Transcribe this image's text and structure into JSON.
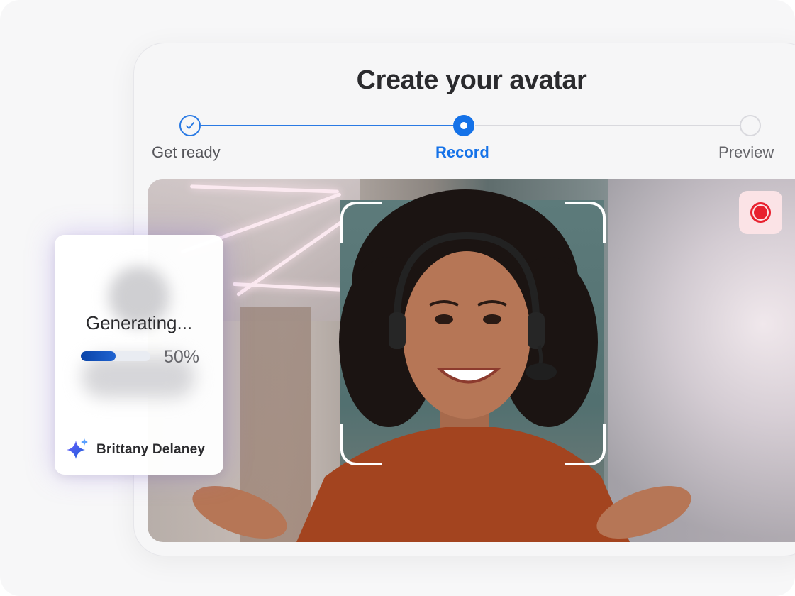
{
  "header": {
    "title": "Create your avatar"
  },
  "stepper": {
    "steps": [
      {
        "label": "Get ready",
        "state": "done"
      },
      {
        "label": "Record",
        "state": "active"
      },
      {
        "label": "Preview",
        "state": "todo"
      }
    ],
    "accent_color": "#1572e8"
  },
  "recorder": {
    "record_icon": "record-icon",
    "record_color": "#e8202e"
  },
  "generating_card": {
    "status": "Generating...",
    "progress_percent": 50,
    "progress_label": "50%",
    "user_name": "Brittany Delaney",
    "user_icon": "sparkle-icon"
  }
}
